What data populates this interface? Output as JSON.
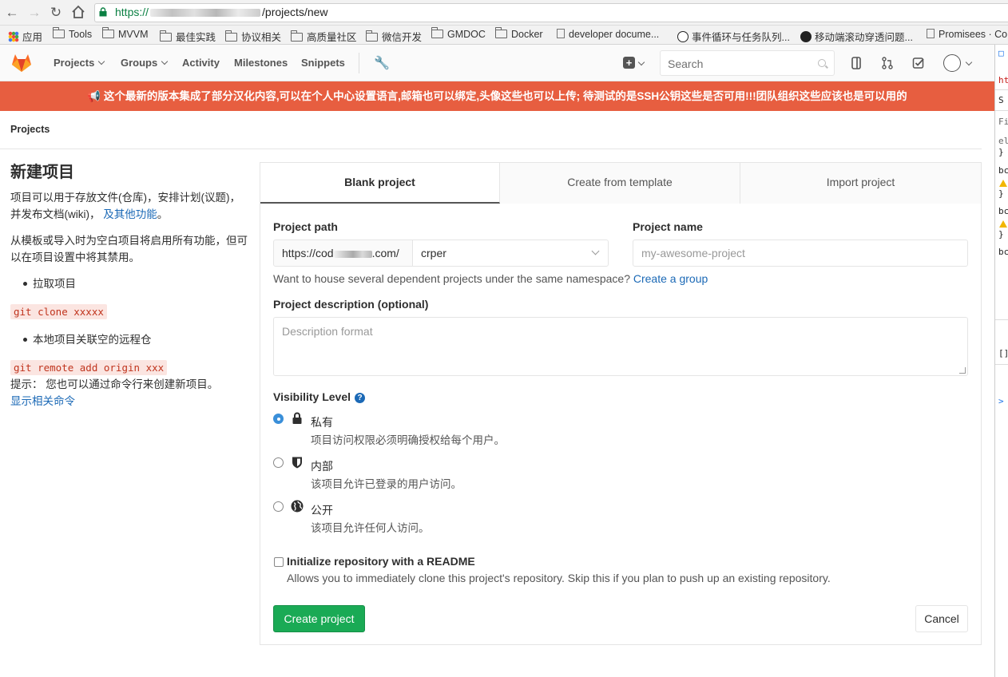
{
  "browser": {
    "url_scheme": "https://",
    "url_path": "/projects/new",
    "bookmarks": [
      {
        "label": "应用",
        "icon": "apps-grid-icon"
      },
      {
        "label": "Tools",
        "icon": "folder-icon"
      },
      {
        "label": "MVVM",
        "icon": "folder-icon"
      },
      {
        "label": "最佳实践",
        "icon": "folder-icon"
      },
      {
        "label": "协议相关",
        "icon": "folder-icon"
      },
      {
        "label": "高质量社区",
        "icon": "folder-icon"
      },
      {
        "label": "微信开发",
        "icon": "folder-icon"
      },
      {
        "label": "GMDOC",
        "icon": "folder-icon"
      },
      {
        "label": "Docker",
        "icon": "folder-icon"
      },
      {
        "label": "developer docume...",
        "icon": "page-icon"
      },
      {
        "label": "事件循环与任务队列...",
        "icon": "site-icon"
      },
      {
        "label": "移动端滚动穿透问题...",
        "icon": "github-icon"
      },
      {
        "label": "Promisees · Co",
        "icon": "page-icon"
      }
    ]
  },
  "nav": {
    "items": [
      "Projects",
      "Groups",
      "Activity",
      "Milestones",
      "Snippets"
    ],
    "search_placeholder": "Search"
  },
  "broadcast": {
    "text": "📢 这个最新的版本集成了部分汉化内容,可以在个人中心设置语言,邮箱也可以绑定,头像这些也可以上传; 待测试的是SSH公钥这些是否可用!!!团队组织这些应该也是可以用的"
  },
  "breadcrumb": "Projects",
  "sidebar": {
    "title": "新建项目",
    "intro": "项目可以用于存放文件(仓库)，安排计划(议题)，并发布文档(wiki)，",
    "intro_link": "及其他功能",
    "intro_end": "。",
    "template_note": "从模板或导入时为空白项目将启用所有功能，但可以在项目设置中将其禁用。",
    "bullet1": "拉取项目",
    "code1": "git clone xxxxx",
    "bullet2": "本地项目关联空的远程仓",
    "code2": "git remote add origin xxx",
    "tip": "提示： 您也可以通过命令行来创建新项目。",
    "tip_link": "显示相关命令"
  },
  "tabs": [
    "Blank project",
    "Create from template",
    "Import project"
  ],
  "form": {
    "path_label": "Project path",
    "path_prefix_start": "https://cod",
    "path_prefix_end": ".com/",
    "namespace": "crper",
    "name_label": "Project name",
    "name_placeholder": "my-awesome-project",
    "help_text": "Want to house several dependent projects under the same namespace?",
    "help_link": "Create a group",
    "desc_label": "Project description (optional)",
    "desc_placeholder": "Description format",
    "visibility_label": "Visibility Level",
    "visibility": [
      {
        "title": "私有",
        "desc": "项目访问权限必须明确授权给每个用户。",
        "checked": true,
        "icon": "lock-icon"
      },
      {
        "title": "内部",
        "desc": "该项目允许已登录的用户访问。",
        "checked": false,
        "icon": "shield-icon"
      },
      {
        "title": "公开",
        "desc": "该项目允许任何人访问。",
        "checked": false,
        "icon": "globe-icon"
      }
    ],
    "readme_label": "Initialize repository with a README",
    "readme_help": "Allows you to immediately clone this project's repository. Skip this if you plan to push up an existing repository.",
    "create_button": "Create project",
    "cancel_button": "Cancel"
  },
  "devtools": {
    "lines": [
      "ht",
      "S",
      "Fi",
      "el",
      "}",
      "bc",
      "}",
      "bc",
      "}",
      "bc",
      "[]",
      ">"
    ]
  }
}
